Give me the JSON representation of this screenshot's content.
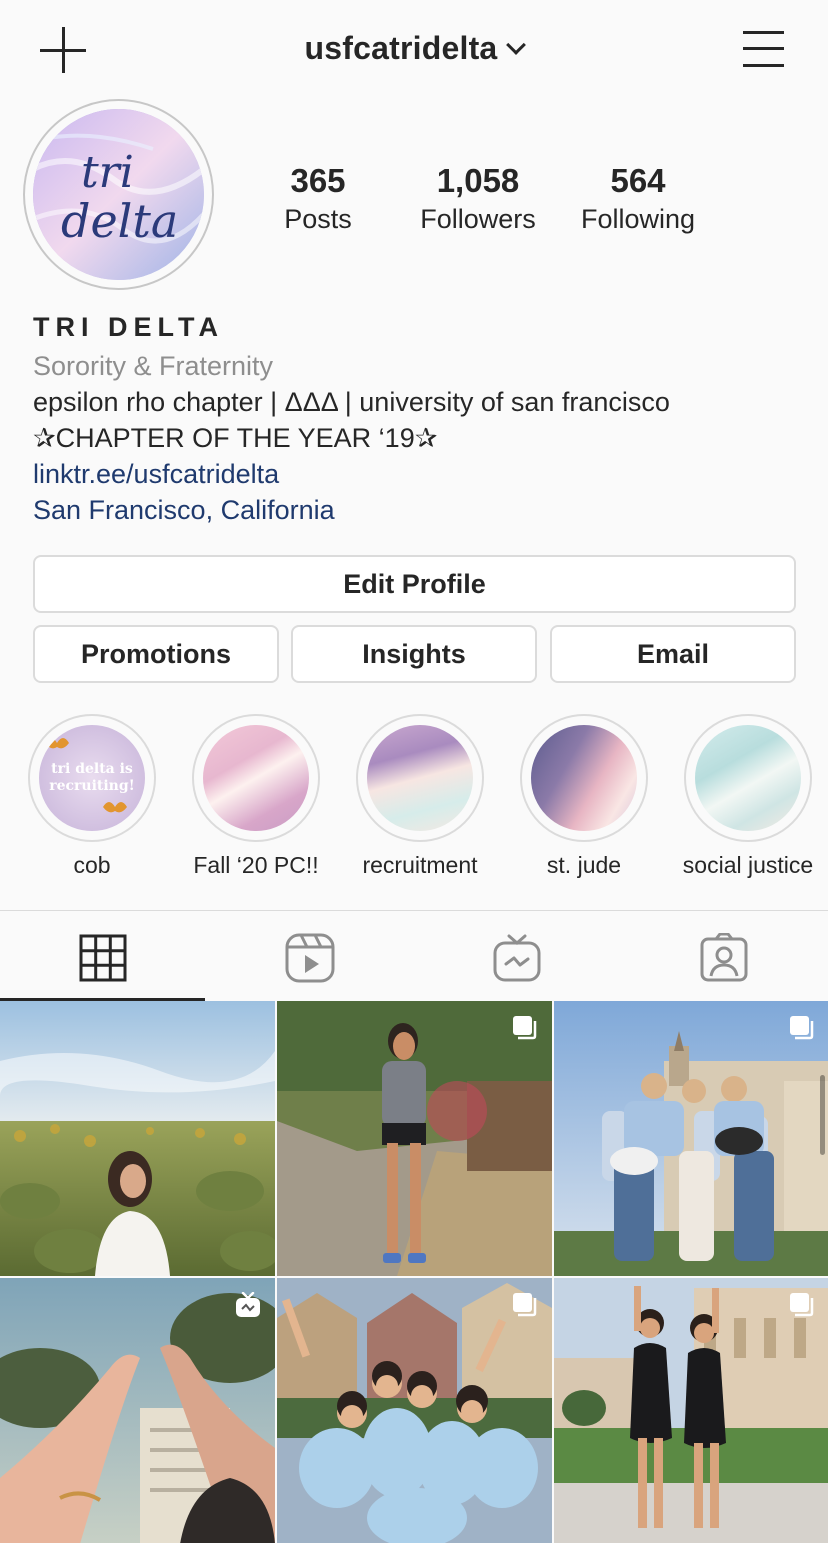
{
  "header": {
    "username": "usfcatridelta",
    "new_post_icon": "plus-icon",
    "dropdown_icon": "chevron-down-icon",
    "menu_icon": "hamburger-menu-icon"
  },
  "profile": {
    "avatar_text": "tri delta",
    "stats": [
      {
        "value": "365",
        "label": "Posts"
      },
      {
        "value": "1,058",
        "label": "Followers"
      },
      {
        "value": "564",
        "label": "Following"
      }
    ],
    "name": "TRI DELTA",
    "category": "Sorority & Fraternity",
    "bio_line1": "epsilon rho chapter | ΔΔΔ | university of san francisco",
    "bio_line2": "✰CHAPTER OF THE YEAR ‘19✰",
    "website": "linktr.ee/usfcatridelta",
    "location": "San Francisco, California"
  },
  "buttons": {
    "edit_profile": "Edit Profile",
    "promotions": "Promotions",
    "insights": "Insights",
    "email": "Email"
  },
  "highlights": [
    {
      "label": "cob",
      "cover_text": "tri delta is recruiting!"
    },
    {
      "label": "Fall ‘20 PC!!"
    },
    {
      "label": "recruitment"
    },
    {
      "label": "st. jude"
    },
    {
      "label": "social justice"
    }
  ],
  "tabs": [
    {
      "name": "grid-icon",
      "active": true
    },
    {
      "name": "reels-icon",
      "active": false
    },
    {
      "name": "igtv-icon",
      "active": false
    },
    {
      "name": "tagged-icon",
      "active": false
    }
  ],
  "posts": [
    {
      "scene": "sunflower field portrait",
      "badge": "none"
    },
    {
      "scene": "woman in St. Jude shirt on path",
      "badge": "carousel-icon"
    },
    {
      "scene": "three women kicking in front of church",
      "badge": "carousel-icon"
    },
    {
      "scene": "hands forming triangle",
      "badge": "igtv-icon"
    },
    {
      "scene": "group in blue shirts by painted ladies",
      "badge": "carousel-icon"
    },
    {
      "scene": "two women posing on lawn",
      "badge": "carousel-icon"
    }
  ],
  "colors": {
    "link": "#1f3a6e",
    "category_gray": "#8e8e8e",
    "border": "#dbdbdb",
    "text": "#262626"
  }
}
